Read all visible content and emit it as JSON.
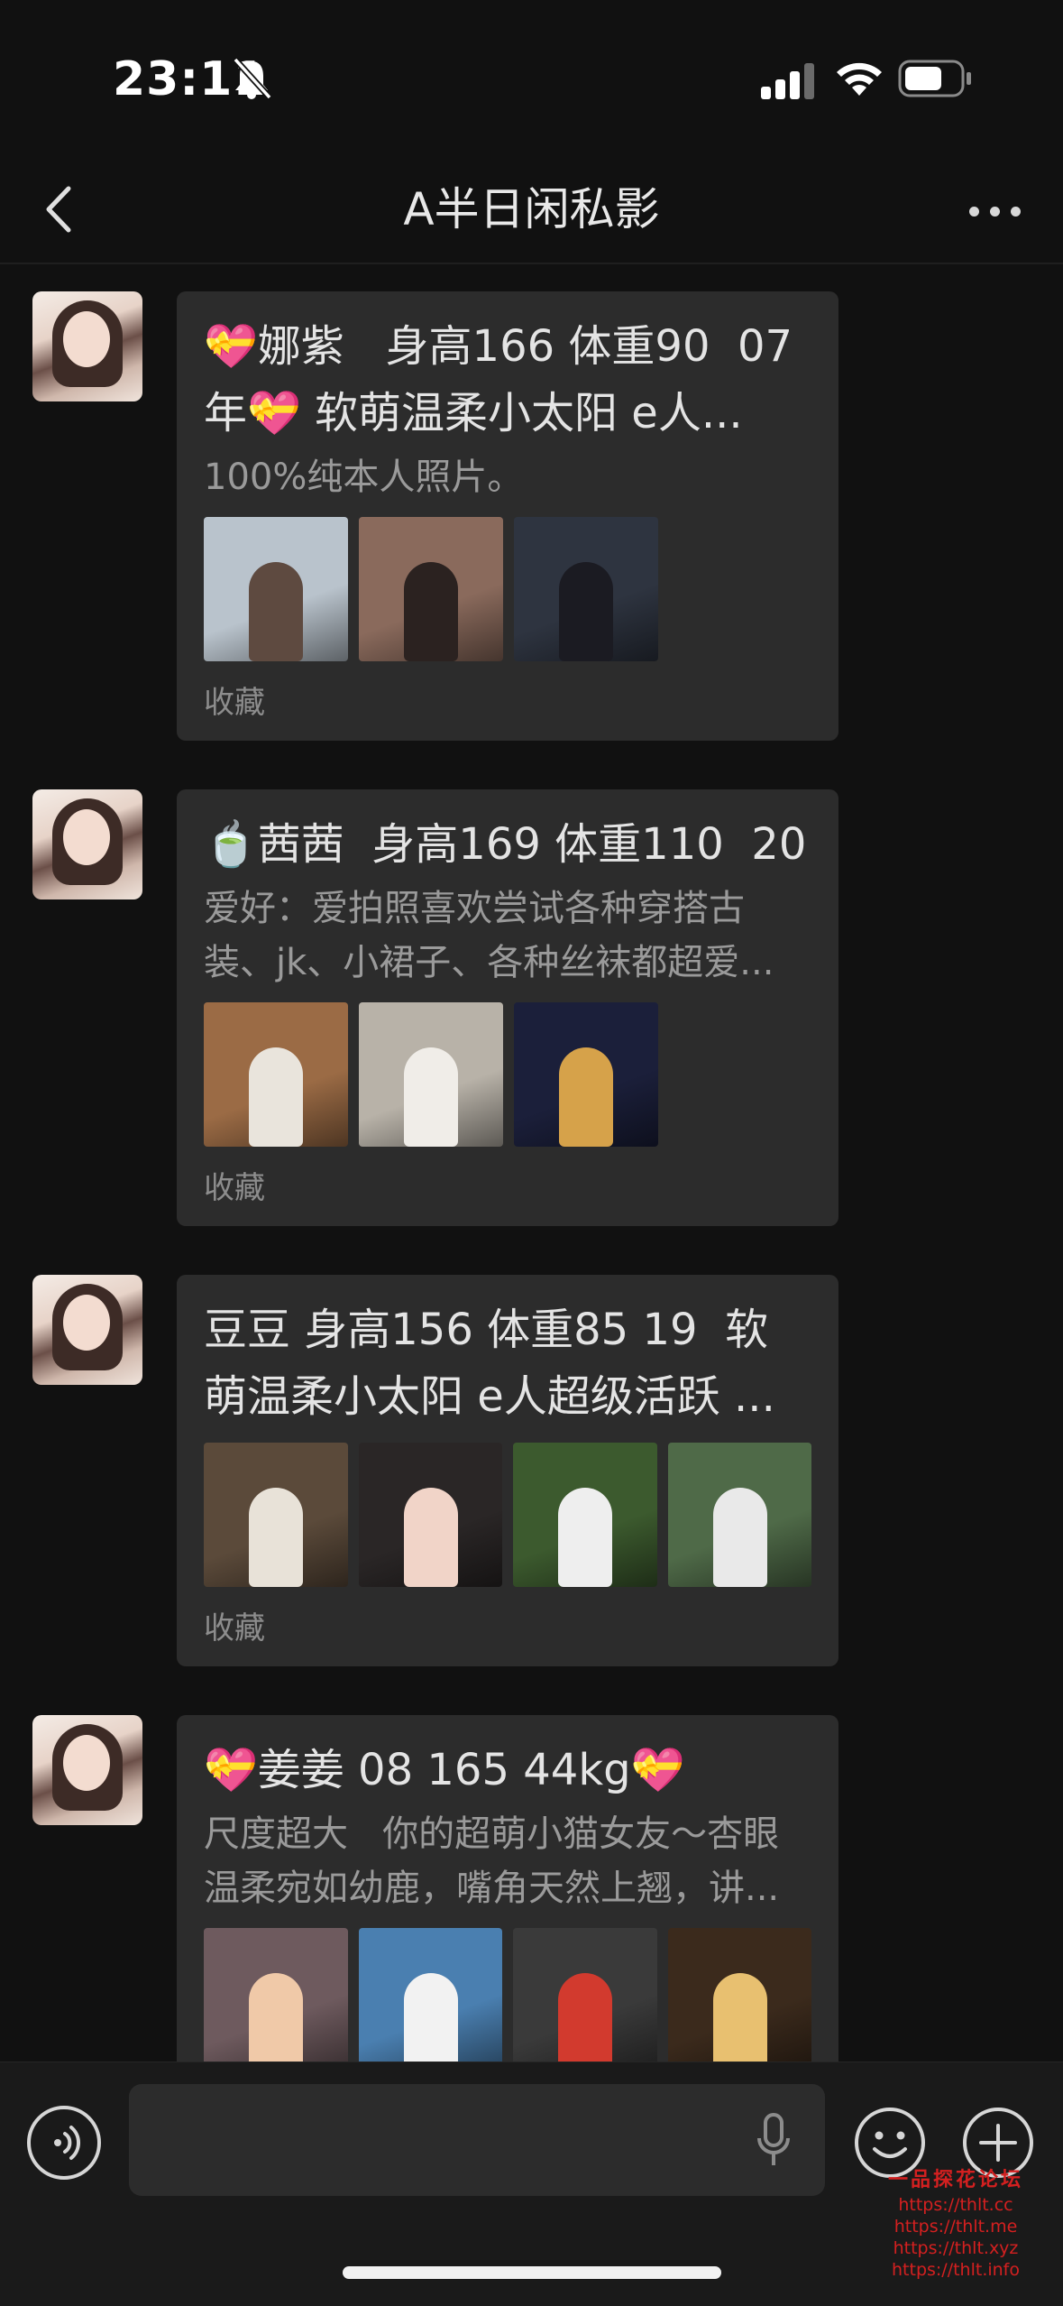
{
  "status_bar": {
    "time": "23:11"
  },
  "nav": {
    "title": "A半日闲私影"
  },
  "messages": [
    {
      "title": "💝娜紫   身高166 体重90  07年💝 软萌温柔小太阳 e人...",
      "desc": "100%纯本人照片。",
      "thumb_colors": [
        [
          "#b9c3cc",
          "#5e4a40"
        ],
        [
          "#8a6a5c",
          "#2b2220"
        ],
        [
          "#2e3440",
          "#1b1b22"
        ]
      ],
      "action": "收藏"
    },
    {
      "title": "🍵茜茜  身高169 体重110  20",
      "desc": "爱好：爱拍照喜欢尝试各种穿搭古装、jk、小裙子、各种丝袜都超爱...",
      "thumb_colors": [
        [
          "#9b6b45",
          "#e9e4dc"
        ],
        [
          "#b8b2a8",
          "#f0ede8"
        ],
        [
          "#1b1f3a",
          "#d6a24a"
        ]
      ],
      "action": "收藏"
    },
    {
      "title": "豆豆 身高156 体重85 19  软萌温柔小太阳 e人超级活跃 ...",
      "desc": "",
      "thumb_colors": [
        [
          "#5b4a3a",
          "#e8e2d8"
        ],
        [
          "#2a2626",
          "#f1d4c8"
        ],
        [
          "#3c5a2e",
          "#eeeeee"
        ],
        [
          "#4f6a48",
          "#e9e9e9"
        ]
      ],
      "action": "收藏"
    },
    {
      "title": "💝姜姜 08 165 44kg💝",
      "desc": "尺度超大   你的超萌小猫女友～杏眼温柔宛如幼鹿，嘴角天然上翘，讲...",
      "thumb_colors": [
        [
          "#6e5a5e",
          "#f0c9a8"
        ],
        [
          "#4a7fb0",
          "#f2f2f2"
        ],
        [
          "#3a3a3a",
          "#d23a2e"
        ],
        [
          "#3b2a1c",
          "#e8c070"
        ]
      ],
      "action": ""
    }
  ],
  "watermark": {
    "title": "一品探花论坛",
    "links": [
      "https://thlt.cc",
      "https://thlt.me",
      "https://thlt.xyz",
      "https://thlt.info"
    ]
  }
}
